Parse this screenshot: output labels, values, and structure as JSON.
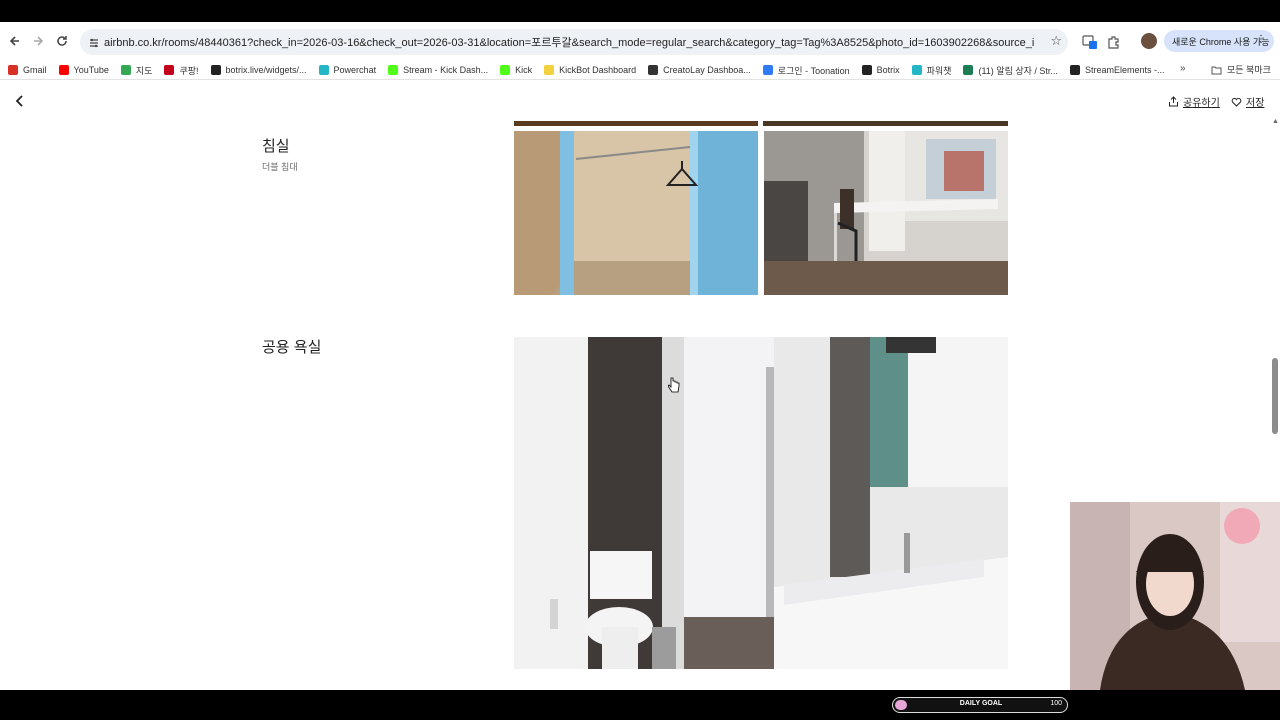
{
  "browser": {
    "url": "airbnb.co.kr/rooms/48440361?check_in=2026-03-16&check_out=2026-03-31&location=포르투갈&search_mode=regular_search&category_tag=Tag%3A8525&photo_id=1603902268&source_impression_id=p3_177294264...",
    "chrome_pill": "새로운 Chrome 사용 가능",
    "bookmarks": [
      {
        "label": "Gmail",
        "color": "#d93025"
      },
      {
        "label": "YouTube",
        "color": "#ff0000"
      },
      {
        "label": "지도",
        "color": "#34a853"
      },
      {
        "label": "쿠팡!",
        "color": "#c4001b"
      },
      {
        "label": "botrix.live/widgets/...",
        "color": "#222222"
      },
      {
        "label": "Powerchat",
        "color": "#23b6c7"
      },
      {
        "label": "Stream - Kick Dash...",
        "color": "#53fc18"
      },
      {
        "label": "Kick",
        "color": "#53fc18"
      },
      {
        "label": "KickBot Dashboard",
        "color": "#f3d03e"
      },
      {
        "label": "CreatoLay Dashboa...",
        "color": "#333333"
      },
      {
        "label": "로그인 - Toonation",
        "color": "#2f7cf6"
      },
      {
        "label": "Botrix",
        "color": "#222222"
      },
      {
        "label": "파워챗",
        "color": "#23b6c7"
      },
      {
        "label": "(11) 알림 상자 / Str...",
        "color": "#1c7c54"
      },
      {
        "label": "StreamElements -...",
        "color": "#222222"
      }
    ],
    "all_bookmarks": "모든 북마크"
  },
  "page": {
    "share_label": "공유하기",
    "save_label": "저장",
    "sections": [
      {
        "title": "침실",
        "subtitle": "더블 침대"
      },
      {
        "title": "공용 욕실",
        "subtitle": ""
      }
    ]
  },
  "overlay": {
    "goal_label": "DAILY GOAL",
    "goal_number": "100",
    "goal_progress": 0.06
  }
}
